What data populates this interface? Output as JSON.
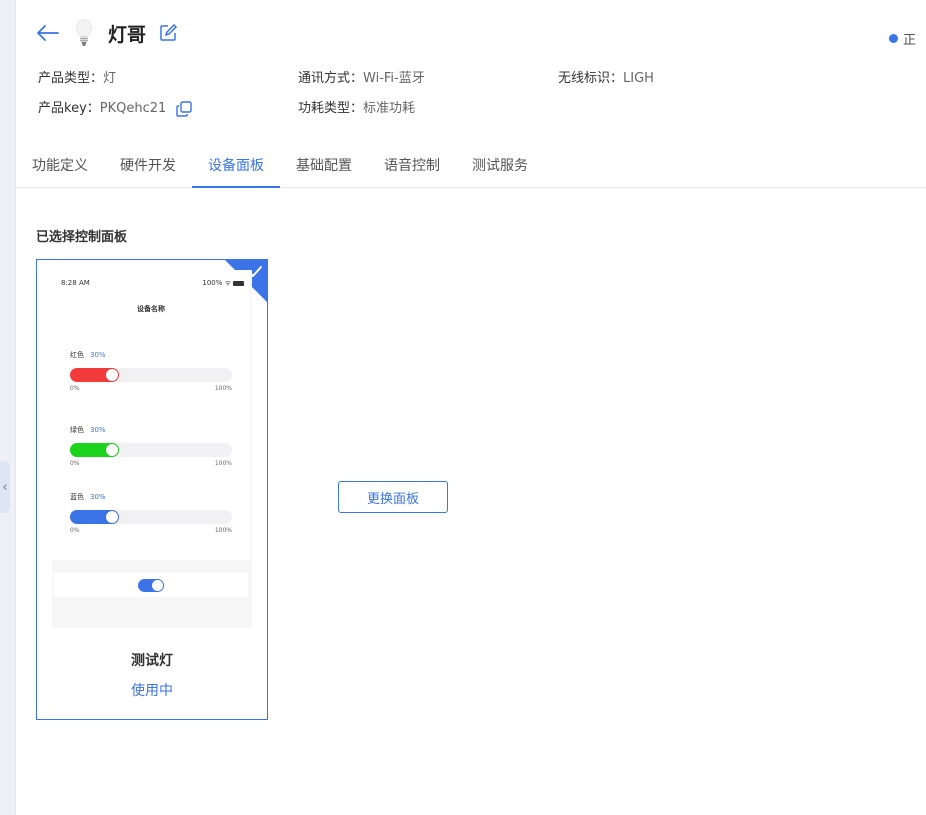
{
  "header": {
    "title": "灯哥",
    "status_text": "正"
  },
  "info": {
    "product_type_label": "产品类型：",
    "product_type_value": "灯",
    "comm_label": "通讯方式：",
    "comm_value": "Wi-Fi-蓝牙",
    "wireless_label": "无线标识：",
    "wireless_value": "LIGH",
    "key_label": "产品key：",
    "key_value": "PKQehc21",
    "power_label": "功耗类型：",
    "power_value": "标准功耗"
  },
  "tabs": [
    {
      "label": "功能定义"
    },
    {
      "label": "硬件开发"
    },
    {
      "label": "设备面板"
    },
    {
      "label": "基础配置"
    },
    {
      "label": "语音控制"
    },
    {
      "label": "测试服务"
    }
  ],
  "active_tab": "设备面板",
  "section_title": "已选择控制面板",
  "panel": {
    "time": "8:28 AM",
    "signal": "100%",
    "device_name": "设备名称",
    "sliders": [
      {
        "label": "红色",
        "percent_text": "30%",
        "value": 0.3,
        "color": "#f33b3b",
        "min": "0%",
        "max": "100%"
      },
      {
        "label": "绿色",
        "percent_text": "30%",
        "value": 0.3,
        "color": "#1bd41b",
        "min": "0%",
        "max": "100%"
      },
      {
        "label": "蓝色",
        "percent_text": "30%",
        "value": 0.3,
        "color": "#3b74e6",
        "min": "0%",
        "max": "100%"
      }
    ],
    "toggle_on": true
  },
  "card": {
    "name": "测试灯",
    "status": "使用中"
  },
  "change_button": "更换面板",
  "colors": {
    "accent": "#3b74e6"
  }
}
